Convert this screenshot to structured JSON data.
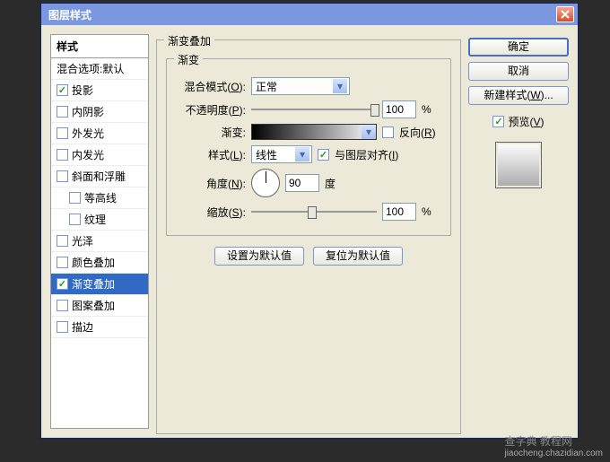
{
  "title": "图层样式",
  "left": {
    "header": "样式",
    "items": [
      {
        "label": "混合选项:默认",
        "checked": null,
        "selected": false,
        "indent": false
      },
      {
        "label": "投影",
        "checked": true,
        "selected": false,
        "indent": false
      },
      {
        "label": "内阴影",
        "checked": false,
        "selected": false,
        "indent": false
      },
      {
        "label": "外发光",
        "checked": false,
        "selected": false,
        "indent": false
      },
      {
        "label": "内发光",
        "checked": false,
        "selected": false,
        "indent": false
      },
      {
        "label": "斜面和浮雕",
        "checked": false,
        "selected": false,
        "indent": false
      },
      {
        "label": "等高线",
        "checked": false,
        "selected": false,
        "indent": true
      },
      {
        "label": "纹理",
        "checked": false,
        "selected": false,
        "indent": true
      },
      {
        "label": "光泽",
        "checked": false,
        "selected": false,
        "indent": false
      },
      {
        "label": "颜色叠加",
        "checked": false,
        "selected": false,
        "indent": false
      },
      {
        "label": "渐变叠加",
        "checked": true,
        "selected": true,
        "indent": false
      },
      {
        "label": "图案叠加",
        "checked": false,
        "selected": false,
        "indent": false
      },
      {
        "label": "描边",
        "checked": false,
        "selected": false,
        "indent": false
      }
    ]
  },
  "center": {
    "section_title": "渐变叠加",
    "group_title": "渐变",
    "blend_mode": {
      "label": "混合模式(",
      "key": "O",
      "suffix": "):",
      "value": "正常"
    },
    "opacity": {
      "label": "不透明度(",
      "key": "P",
      "suffix": "):",
      "value": "100",
      "unit": "%",
      "thumb_pct": 95
    },
    "gradient": {
      "label": "渐变:",
      "reverse_label": "反向(",
      "reverse_key": "R",
      "reverse_suffix": ")",
      "reverse_checked": false
    },
    "style": {
      "label": "样式(",
      "key": "L",
      "suffix": "):",
      "value": "线性",
      "align_label": "与图层对齐(",
      "align_key": "I",
      "align_suffix": ")",
      "align_checked": true
    },
    "angle": {
      "label": "角度(",
      "key": "N",
      "suffix": "):",
      "value": "90",
      "unit": "度"
    },
    "scale": {
      "label": "缩放(",
      "key": "S",
      "suffix": "):",
      "value": "100",
      "unit": "%",
      "thumb_pct": 45
    },
    "set_default": "设置为默认值",
    "reset_default": "复位为默认值"
  },
  "right": {
    "ok": "确定",
    "cancel": "取消",
    "new_style": "新建样式(",
    "new_style_key": "W",
    "new_style_suffix": ")...",
    "preview_label": "预览(",
    "preview_key": "V",
    "preview_suffix": ")",
    "preview_checked": true
  },
  "watermark": {
    "main": "查字典 教程网",
    "sub": "jiaocheng.chazidian.com"
  }
}
